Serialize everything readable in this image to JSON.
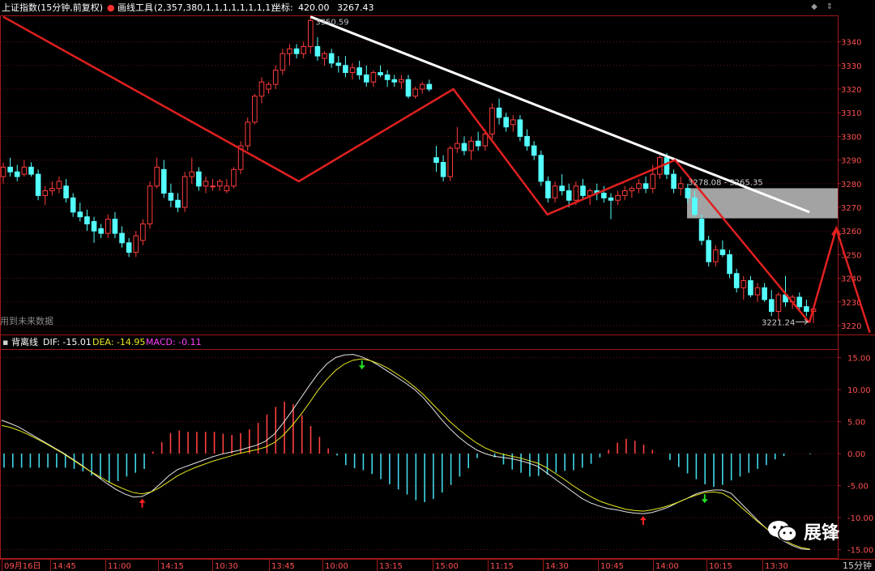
{
  "header": {
    "index_name": "上证指数(15分钟,前复权)",
    "tool_label": "画线工具",
    "tool_params": "(2,357,380,1,1,1,1,1,1,1,1)",
    "coord_label": "坐标:",
    "coord_x": "420.00",
    "coord_y": "3267.43"
  },
  "indicator": {
    "name": "背离线",
    "dif_label": "DIF: -15.01",
    "dea_label": "DEA: -14.95",
    "macd_label": "MACD: -0.11"
  },
  "future_label": "用到未来数据",
  "period_label": "15分钟",
  "watermark": "展锋",
  "icons": [
    "diamond-icon",
    "swap-icon",
    "wechat-icon",
    "up-arrow-signal",
    "down-arrow-signal"
  ],
  "colors": {
    "up": "#ff3b3b",
    "down": "#54ffff",
    "trend": "#e02020",
    "resistance": "#ffffff",
    "zone": "#c0c0c0",
    "dif": "#e6e6e6",
    "dea": "#e8e820",
    "macd_label": "#ff40ff"
  },
  "chart_data": [
    {
      "type": "candlestick",
      "title": "上证指数(15分钟,前复权)",
      "ylim": [
        3216,
        3358
      ],
      "y_ticks": [
        3220,
        3230,
        3240,
        3250,
        3260,
        3270,
        3280,
        3290,
        3300,
        3310,
        3320,
        3330,
        3340
      ],
      "x_ticks": [
        "09月16日",
        "14:45",
        "11:00",
        "14:15",
        "10:30",
        "13:45",
        "10:00",
        "13:15",
        "15:00",
        "11:15",
        "14:30",
        "10:45",
        "14:00",
        "10:15",
        "13:30"
      ],
      "grid": true,
      "annotations": {
        "high_label": "3350.59",
        "low_label": "3221.24",
        "zone_label": "3278.08 - 3265.35",
        "zone": [
          3265.35,
          3278.08
        ]
      },
      "candles": [
        [
          3283,
          3289,
          3280,
          3287
        ],
        [
          3287,
          3291,
          3283,
          3285
        ],
        [
          3285,
          3288,
          3281,
          3283
        ],
        [
          3284,
          3290,
          3283,
          3287
        ],
        [
          3287,
          3289,
          3283,
          3284
        ],
        [
          3284,
          3286,
          3273,
          3275
        ],
        [
          3275,
          3279,
          3271,
          3277
        ],
        [
          3277,
          3281,
          3275,
          3278
        ],
        [
          3278,
          3283,
          3276,
          3281
        ],
        [
          3279,
          3282,
          3272,
          3274
        ],
        [
          3274,
          3276,
          3266,
          3268
        ],
        [
          3268,
          3272,
          3264,
          3266
        ],
        [
          3266,
          3269,
          3260,
          3263
        ],
        [
          3264,
          3266,
          3255,
          3260
        ],
        [
          3261,
          3263,
          3257,
          3259
        ],
        [
          3259,
          3267,
          3257,
          3265
        ],
        [
          3265,
          3268,
          3257,
          3259
        ],
        [
          3259,
          3262,
          3253,
          3255
        ],
        [
          3255,
          3257,
          3249,
          3251
        ],
        [
          3251,
          3260,
          3249,
          3258
        ],
        [
          3256,
          3265,
          3254,
          3263
        ],
        [
          3263,
          3281,
          3261,
          3279
        ],
        [
          3279,
          3291,
          3278,
          3287
        ],
        [
          3286,
          3290,
          3274,
          3276
        ],
        [
          3276,
          3280,
          3270,
          3273
        ],
        [
          3273,
          3276,
          3268,
          3270
        ],
        [
          3270,
          3285,
          3268,
          3283
        ],
        [
          3283,
          3291,
          3280,
          3285
        ],
        [
          3285,
          3287,
          3277,
          3279
        ],
        [
          3279,
          3283,
          3276,
          3281
        ],
        [
          3279,
          3282,
          3277,
          3279
        ],
        [
          3279,
          3282,
          3277,
          3281
        ],
        [
          3277,
          3282,
          3276,
          3279
        ],
        [
          3279,
          3287,
          3278,
          3286
        ],
        [
          3286,
          3298,
          3284,
          3296
        ],
        [
          3296,
          3308,
          3294,
          3306
        ],
        [
          3306,
          3318,
          3305,
          3317
        ],
        [
          3317,
          3325,
          3314,
          3323
        ],
        [
          3320,
          3323,
          3318,
          3322
        ],
        [
          3322,
          3330,
          3320,
          3328
        ],
        [
          3328,
          3337,
          3326,
          3335
        ],
        [
          3335,
          3339,
          3330,
          3337
        ],
        [
          3337,
          3339,
          3333,
          3335
        ],
        [
          3335,
          3340,
          3333,
          3338
        ],
        [
          3338,
          3351,
          3335,
          3349
        ],
        [
          3338,
          3342,
          3332,
          3334
        ],
        [
          3333,
          3336,
          3330,
          3335
        ],
        [
          3335,
          3337,
          3329,
          3331
        ],
        [
          3331,
          3334,
          3327,
          3330
        ],
        [
          3330,
          3334,
          3325,
          3327
        ],
        [
          3327,
          3331,
          3324,
          3329
        ],
        [
          3329,
          3332,
          3324,
          3326
        ],
        [
          3326,
          3330,
          3321,
          3323
        ],
        [
          3323,
          3328,
          3321,
          3327
        ],
        [
          3327,
          3330,
          3325,
          3326
        ],
        [
          3326,
          3328,
          3321,
          3324
        ],
        [
          3324,
          3326,
          3321,
          3323
        ],
        [
          3323,
          3326,
          3320,
          3324
        ],
        [
          3324,
          3326,
          3316,
          3317
        ],
        [
          3317,
          3321,
          3316,
          3320
        ],
        [
          3320,
          3323,
          3318,
          3322
        ],
        [
          3322,
          3324,
          3319,
          3320
        ],
        [
          3291,
          3296,
          3285,
          3289
        ],
        [
          3289,
          3292,
          3281,
          3283
        ],
        [
          3283,
          3296,
          3281,
          3295
        ],
        [
          3295,
          3304,
          3293,
          3297
        ],
        [
          3297,
          3300,
          3292,
          3294
        ],
        [
          3294,
          3300,
          3290,
          3298
        ],
        [
          3298,
          3302,
          3294,
          3296
        ],
        [
          3296,
          3303,
          3294,
          3301
        ],
        [
          3301,
          3314,
          3299,
          3312
        ],
        [
          3312,
          3316,
          3305,
          3308
        ],
        [
          3308,
          3310,
          3302,
          3304
        ],
        [
          3305,
          3309,
          3302,
          3307
        ],
        [
          3307,
          3309,
          3298,
          3300
        ],
        [
          3300,
          3303,
          3294,
          3296
        ],
        [
          3296,
          3298,
          3290,
          3292
        ],
        [
          3292,
          3294,
          3279,
          3281
        ],
        [
          3281,
          3283,
          3272,
          3274
        ],
        [
          3274,
          3281,
          3272,
          3279
        ],
        [
          3279,
          3284,
          3275,
          3277
        ],
        [
          3277,
          3280,
          3270,
          3273
        ],
        [
          3273,
          3281,
          3271,
          3279
        ],
        [
          3279,
          3282,
          3273,
          3275
        ],
        [
          3275,
          3278,
          3271,
          3277
        ],
        [
          3277,
          3280,
          3273,
          3276
        ],
        [
          3276,
          3279,
          3272,
          3274
        ],
        [
          3274,
          3276,
          3265,
          3273
        ],
        [
          3273,
          3277,
          3271,
          3275
        ],
        [
          3275,
          3279,
          3273,
          3277
        ],
        [
          3277,
          3279,
          3274,
          3278
        ],
        [
          3278,
          3282,
          3276,
          3280
        ],
        [
          3280,
          3283,
          3276,
          3278
        ],
        [
          3278,
          3288,
          3276,
          3284
        ],
        [
          3284,
          3292,
          3282,
          3291
        ],
        [
          3291,
          3293,
          3282,
          3284
        ],
        [
          3284,
          3286,
          3276,
          3278
        ],
        [
          3278,
          3283,
          3275,
          3280
        ],
        [
          3278,
          3280,
          3272,
          3274
        ],
        [
          3274,
          3277,
          3266,
          3267
        ],
        [
          3265,
          3267,
          3254,
          3256
        ],
        [
          3256,
          3258,
          3245,
          3247
        ],
        [
          3247,
          3254,
          3245,
          3252
        ],
        [
          3252,
          3256,
          3249,
          3250
        ],
        [
          3250,
          3252,
          3240,
          3242
        ],
        [
          3242,
          3244,
          3234,
          3236
        ],
        [
          3236,
          3241,
          3231,
          3239
        ],
        [
          3239,
          3241,
          3232,
          3233
        ],
        [
          3233,
          3238,
          3230,
          3236
        ],
        [
          3236,
          3238,
          3230,
          3231
        ],
        [
          3231,
          3235,
          3224,
          3226
        ],
        [
          3226,
          3234,
          3222,
          3233
        ],
        [
          3233,
          3241,
          3228,
          3230
        ],
        [
          3230,
          3233,
          3227,
          3232
        ],
        [
          3232,
          3234,
          3226,
          3228
        ],
        [
          3228,
          3231,
          3224,
          3226
        ],
        [
          3226,
          3228,
          3221,
          3227
        ]
      ],
      "trend_line": [
        [
          0,
          3350.59
        ],
        [
          44,
          3281
        ],
        [
          67,
          3320
        ],
        [
          81,
          3267
        ],
        [
          100,
          3290
        ],
        [
          120,
          3221.24
        ]
      ],
      "projection": [
        [
          120,
          3221.24
        ],
        [
          124,
          3261
        ],
        [
          129,
          3217
        ]
      ],
      "resistance_line": [
        [
          0,
          3350.59
        ],
        [
          124,
          3268
        ]
      ]
    },
    {
      "type": "macd",
      "title": "背离线",
      "ylim": [
        -16.5,
        18.5
      ],
      "y_ticks": [
        "15.00",
        "10.00",
        "5.00",
        "0.00",
        "-5.00",
        "-10.00",
        "-15.00"
      ],
      "grid": true,
      "dif": [
        5.2,
        4.7,
        4.1,
        3.3,
        2.5,
        1.7,
        0.9,
        0.1,
        -0.8,
        -1.7,
        -2.7,
        -3.7,
        -4.7,
        -5.6,
        -6.3,
        -6.8,
        -6.7,
        -6.0,
        -4.8,
        -3.5,
        -2.5,
        -2.0,
        -1.5,
        -1.0,
        -0.5,
        -0.1,
        0.2,
        0.5,
        0.9,
        1.3,
        1.9,
        3.0,
        4.7,
        6.6,
        8.6,
        10.6,
        12.5,
        14.0,
        15.0,
        15.4,
        15.5,
        15.1,
        14.5,
        13.7,
        12.8,
        11.9,
        11.0,
        10.0,
        8.7,
        7.1,
        5.4,
        3.9,
        2.6,
        1.5,
        0.6,
        0.0,
        -0.4,
        -0.6,
        -0.8,
        -1.1,
        -1.5,
        -2.0,
        -3.0,
        -4.0,
        -5.0,
        -6.0,
        -7.0,
        -7.7,
        -8.2,
        -8.6,
        -8.8,
        -9.1,
        -9.3,
        -9.4,
        -9.2,
        -8.8,
        -8.3,
        -7.6,
        -7.0,
        -6.3,
        -5.9,
        -5.7,
        -5.7,
        -6.2,
        -7.6,
        -9.0,
        -10.4,
        -11.7,
        -12.8,
        -13.7,
        -14.4,
        -14.9,
        -15.0
      ],
      "dea": [
        4.4,
        4.1,
        3.6,
        3.0,
        2.3,
        1.6,
        0.8,
        0.0,
        -0.9,
        -1.8,
        -2.7,
        -3.5,
        -4.3,
        -5.0,
        -5.6,
        -6.1,
        -6.3,
        -6.0,
        -5.3,
        -4.4,
        -3.5,
        -2.8,
        -2.2,
        -1.7,
        -1.2,
        -0.8,
        -0.4,
        0.0,
        0.3,
        0.6,
        1.0,
        1.7,
        2.8,
        4.3,
        6.0,
        7.9,
        9.9,
        11.6,
        13.0,
        14.0,
        14.6,
        14.8,
        14.5,
        14.0,
        13.3,
        12.4,
        11.5,
        10.4,
        9.2,
        7.8,
        6.4,
        5.0,
        3.8,
        2.7,
        1.7,
        0.9,
        0.3,
        -0.1,
        -0.4,
        -0.7,
        -1.1,
        -1.5,
        -2.2,
        -3.1,
        -4.0,
        -5.0,
        -5.9,
        -6.7,
        -7.4,
        -7.9,
        -8.3,
        -8.7,
        -8.9,
        -9.0,
        -8.8,
        -8.5,
        -8.1,
        -7.6,
        -7.0,
        -6.5,
        -6.1,
        -6.0,
        -6.2,
        -7.0,
        -8.2,
        -9.4,
        -10.6,
        -11.7,
        -12.7,
        -13.5,
        -14.2,
        -14.7,
        -14.95
      ],
      "macd": [
        -2.2,
        -2.2,
        -2.2,
        -2.2,
        -2.2,
        -2.2,
        -2.2,
        -2.2,
        -2.4,
        -2.8,
        -3.4,
        -4.0,
        -4.6,
        -4.3,
        -3.6,
        -3.0,
        -2.4,
        0.3,
        1.8,
        3.2,
        3.6,
        3.4,
        3.4,
        3.4,
        3.4,
        3.1,
        2.9,
        3.2,
        3.8,
        4.8,
        6.1,
        7.3,
        8.1,
        7.7,
        6.0,
        4.3,
        2.6,
        0.8,
        -0.3,
        -1.8,
        -2.3,
        -2.6,
        -3.2,
        -4.0,
        -4.8,
        -5.6,
        -6.4,
        -7.3,
        -7.6,
        -7.1,
        -6.1,
        -4.9,
        -3.6,
        -2.3,
        -0.7,
        0.0,
        -0.6,
        -1.7,
        -2.5,
        -3.0,
        -3.6,
        -3.5,
        -3.3,
        -3.0,
        -2.7,
        -2.6,
        -2.2,
        -1.6,
        -0.6,
        0.6,
        1.7,
        2.3,
        2.0,
        1.4,
        0.6,
        0.0,
        -1.0,
        -2.1,
        -3.1,
        -4.0,
        -4.8,
        -5.2,
        -4.9,
        -4.2,
        -3.6,
        -3.0,
        -2.4,
        -1.8,
        -0.9,
        -0.4,
        0.0,
        0.0,
        -0.11
      ],
      "signals": [
        {
          "i": 16,
          "type": "up"
        },
        {
          "i": 41,
          "type": "down"
        },
        {
          "i": 73,
          "type": "up"
        },
        {
          "i": 80,
          "type": "down"
        }
      ]
    }
  ]
}
